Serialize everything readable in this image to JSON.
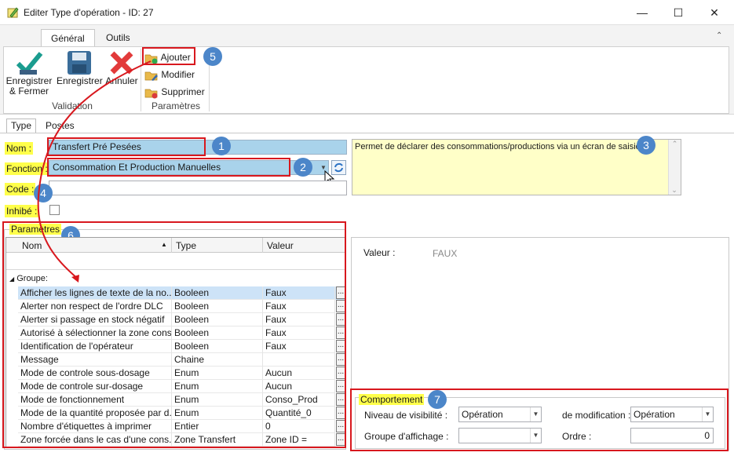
{
  "window": {
    "title": "Editer Type d'opération - ID: 27"
  },
  "ribbon": {
    "tabs": [
      "Général",
      "Outils"
    ],
    "save_close": "Enregistrer\n& Fermer",
    "save": "Enregistrer",
    "cancel": "Annuler",
    "group_validation": "Validation",
    "add": "Ajouter",
    "modify": "Modifier",
    "delete": "Supprimer",
    "group_params": "Paramètres"
  },
  "subtabs": [
    "Type",
    "Postes"
  ],
  "form": {
    "nom_label": "Nom :",
    "nom_value": "Transfert Pré Pesées",
    "fonction_label": "Fonction :",
    "fonction_value": "Consommation Et Production Manuelles",
    "code_label": "Code :",
    "code_value": "",
    "inhibe_label": "Inhibé :",
    "description": "Permet de déclarer des consommations/productions via un écran de saisie."
  },
  "params": {
    "title": "Paramètres",
    "columns": [
      "Nom",
      "Type",
      "Valeur"
    ],
    "group_label": "Groupe:",
    "rows": [
      {
        "name": "Afficher les lignes de texte de la no...",
        "type": "Booleen",
        "value": "Faux"
      },
      {
        "name": "Alerter non respect de l'ordre DLC",
        "type": "Booleen",
        "value": "Faux"
      },
      {
        "name": "Alerter si passage en stock négatif",
        "type": "Booleen",
        "value": "Faux"
      },
      {
        "name": "Autorisé à sélectionner la zone cons...",
        "type": "Booleen",
        "value": "Faux"
      },
      {
        "name": "Identification de l'opérateur",
        "type": "Booleen",
        "value": "Faux"
      },
      {
        "name": "Message",
        "type": "Chaine",
        "value": ""
      },
      {
        "name": "Mode de controle sous-dosage",
        "type": "Enum",
        "value": "Aucun"
      },
      {
        "name": "Mode de controle sur-dosage",
        "type": "Enum",
        "value": "Aucun"
      },
      {
        "name": "Mode de fonctionnement",
        "type": "Enum",
        "value": "Conso_Prod"
      },
      {
        "name": "Mode de la quantité proposée par d...",
        "type": "Enum",
        "value": "Quantité_0"
      },
      {
        "name": "Nombre d'étiquettes à imprimer",
        "type": "Entier",
        "value": "0"
      },
      {
        "name": "Zone forcée dans le cas d'une cons...",
        "type": "Zone Transfert",
        "value": "Zone ID ="
      }
    ]
  },
  "detail": {
    "label": "Valeur :",
    "value": "FAUX"
  },
  "comportement": {
    "title": "Comportement",
    "visibility_label": "Niveau de visibilité :",
    "visibility_value": "Opération",
    "modification_label": "de modification :",
    "modification_value": "Opération",
    "group_label": "Groupe d'affichage :",
    "group_value": "",
    "order_label": "Ordre :",
    "order_value": "0"
  },
  "callouts": [
    "1",
    "2",
    "3",
    "4",
    "5",
    "6",
    "7"
  ],
  "colors": {
    "highlight_red": "#d8181e",
    "callout_blue": "#4c86c9",
    "yellow": "#ffff4a",
    "field_blue": "#a9d3eb"
  }
}
